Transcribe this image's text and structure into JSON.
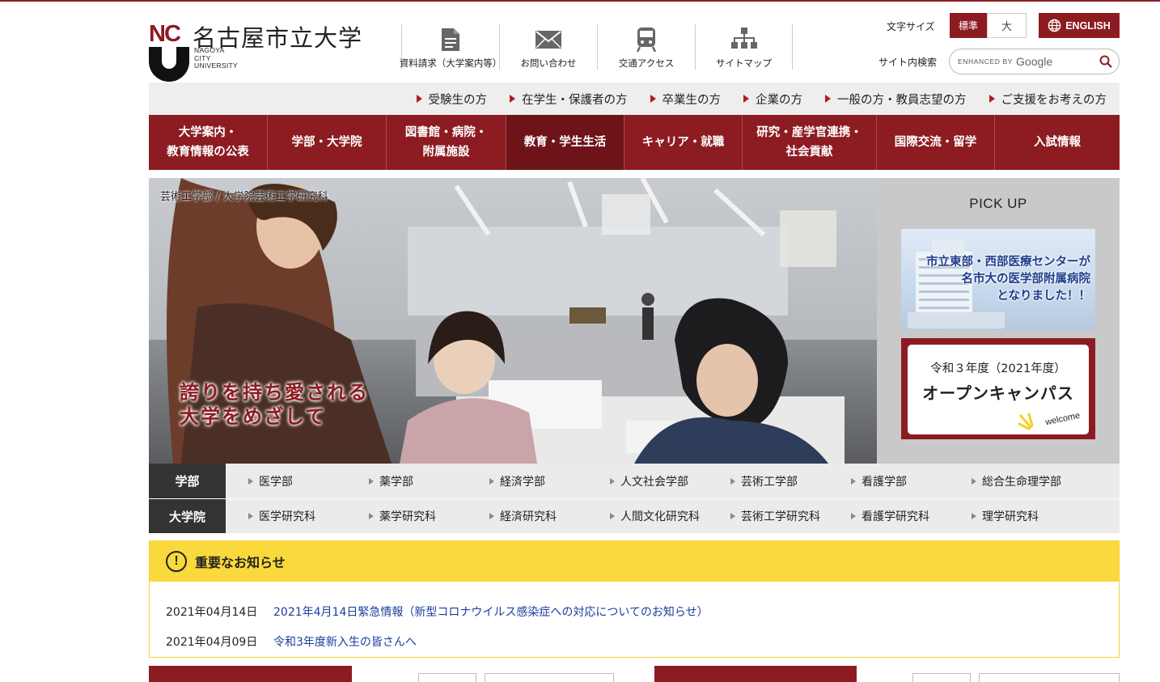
{
  "brand": {
    "logo_letters": "NC",
    "name_ja": "名古屋市立大学",
    "name_en_lines": [
      "NAGOYA",
      "CITY",
      "UNIVERSITY"
    ],
    "color": "#8c1c22"
  },
  "header": {
    "quick_links": [
      {
        "label": "資料請求（大学案内等）",
        "icon": "document-icon"
      },
      {
        "label": "お問い合わせ",
        "icon": "mail-icon"
      },
      {
        "label": "交通アクセス",
        "icon": "train-icon"
      },
      {
        "label": "サイトマップ",
        "icon": "sitemap-icon"
      }
    ],
    "font_size": {
      "label": "文字サイズ",
      "standard": "標準",
      "large": "大",
      "selected": "標準"
    },
    "english_label": "ENGLISH",
    "search": {
      "label": "サイト内検索",
      "enhanced_by": "ENHANCED BY",
      "google": "Google"
    }
  },
  "audience_links": [
    "受験生の方",
    "在学生・保護者の方",
    "卒業生の方",
    "企業の方",
    "一般の方・教員志望の方",
    "ご支援をお考えの方"
  ],
  "main_nav": [
    {
      "line1": "大学案内・",
      "line2": "教育情報の公表"
    },
    {
      "line1": "学部・大学院",
      "line2": ""
    },
    {
      "line1": "図書館・病院・",
      "line2": "附属施設"
    },
    {
      "line1": "教育・学生生活",
      "line2": ""
    },
    {
      "line1": "キャリア・就職",
      "line2": ""
    },
    {
      "line1": "研究・産学官連携・",
      "line2": "社会貢献"
    },
    {
      "line1": "国際交流・留学",
      "line2": ""
    },
    {
      "line1": "入試情報",
      "line2": ""
    }
  ],
  "hero": {
    "caption": "芸術工学部 / 大学院芸術工学研究科",
    "slogan_line1": "誇りを持ち愛される",
    "slogan_line2": "大学をめざして"
  },
  "pickup": {
    "title": "PICK UP",
    "banner1_lines": [
      "市立東部・西部医療センターが",
      "名市大の医学部附属病院",
      "となりました！！"
    ],
    "banner2_year": "令和３年度（2021年度）",
    "banner2_title": "オープンキャンパス",
    "banner2_welcome": "welcome"
  },
  "faculties": {
    "undergrad_label": "学部",
    "undergrad": [
      "医学部",
      "薬学部",
      "経済学部",
      "人文社会学部",
      "芸術工学部",
      "看護学部",
      "総合生命理学部"
    ],
    "grad_label": "大学院",
    "grad": [
      "医学研究科",
      "薬学研究科",
      "経済研究科",
      "人間文化研究科",
      "芸術工学研究科",
      "看護学研究科",
      "理学研究科"
    ]
  },
  "notices": {
    "title": "重要なお知らせ",
    "icon": "exclamation-icon",
    "items": [
      {
        "date": "2021年04月14日",
        "text": "2021年4月14日緊急情報（新型コロナウイルス感染症への対応についてのお知らせ）"
      },
      {
        "date": "2021年04月09日",
        "text": "令和3年度新入生の皆さんへ"
      }
    ]
  }
}
